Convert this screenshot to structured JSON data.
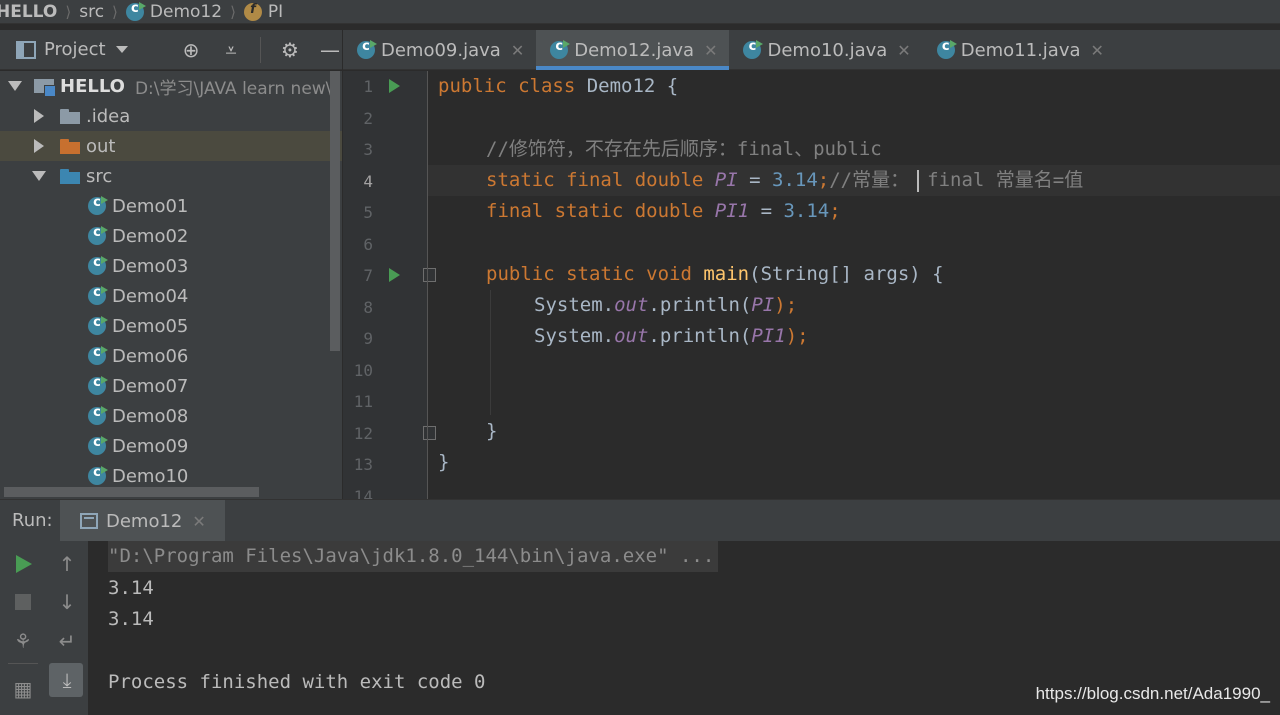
{
  "breadcrumb": {
    "project": "HELLO",
    "folder": "src",
    "file": "Demo12",
    "member": "PI"
  },
  "project_panel": {
    "title": "Project",
    "icons": [
      "target-icon",
      "collapse-icon",
      "gear-icon",
      "minimize-icon"
    ]
  },
  "tree": {
    "root_label": "HELLO",
    "root_path": "D:\\学习\\JAVA learn new\\",
    "idea": ".idea",
    "out": "out",
    "src": "src",
    "files": [
      "Demo01",
      "Demo02",
      "Demo03",
      "Demo04",
      "Demo05",
      "Demo06",
      "Demo07",
      "Demo08",
      "Demo09",
      "Demo10"
    ]
  },
  "tabs": [
    {
      "label": "Demo09.java",
      "active": false
    },
    {
      "label": "Demo12.java",
      "active": true
    },
    {
      "label": "Demo10.java",
      "active": false
    },
    {
      "label": "Demo11.java",
      "active": false
    }
  ],
  "editor": {
    "line_numbers": [
      "1",
      "2",
      "3",
      "4",
      "5",
      "6",
      "7",
      "8",
      "9",
      "10",
      "11",
      "12",
      "13",
      "14"
    ],
    "current_line": "4",
    "lines": {
      "l1_kw": "public class",
      "l1_rest": " Demo12 {",
      "l3_comment": "//修饰符，不存在先后顺序：final、public",
      "l4_kw": "static final double",
      "l4_field": "PI",
      "l4_eq": " = ",
      "l4_num": "3.14",
      "l4_semi": ";",
      "l4_comment_a": "//常量：",
      "l4_comment_b": "final 常量名=值",
      "l5_kw": "final static double",
      "l5_field": "PI1",
      "l5_eq": " = ",
      "l5_num": "3.14",
      "l5_semi": ";",
      "l7_kw": "public static void",
      "l7_fn": "main",
      "l7_rest": "(String[] args) {",
      "l8_pre": "System.",
      "l8_out": "out",
      "l8_mid": ".println(",
      "l8_arg": "PI",
      "l8_end": ");",
      "l9_pre": "System.",
      "l9_out": "out",
      "l9_mid": ".println(",
      "l9_arg": "PI1",
      "l9_end": ");",
      "l12_brace": "}",
      "l13_brace": "}"
    }
  },
  "run": {
    "label": "Run:",
    "tab_label": "Demo12",
    "console": [
      "\"D:\\Program Files\\Java\\jdk1.8.0_144\\bin\\java.exe\" ...",
      "3.14",
      "3.14",
      "",
      "Process finished with exit code 0"
    ]
  },
  "watermark": "https://blog.csdn.net/Ada1990_",
  "colors": {
    "keyword": "#cc7832",
    "field": "#9876aa",
    "number": "#6897bb",
    "comment": "#808080",
    "function": "#ffc66d",
    "accent": "#4a88c7"
  }
}
